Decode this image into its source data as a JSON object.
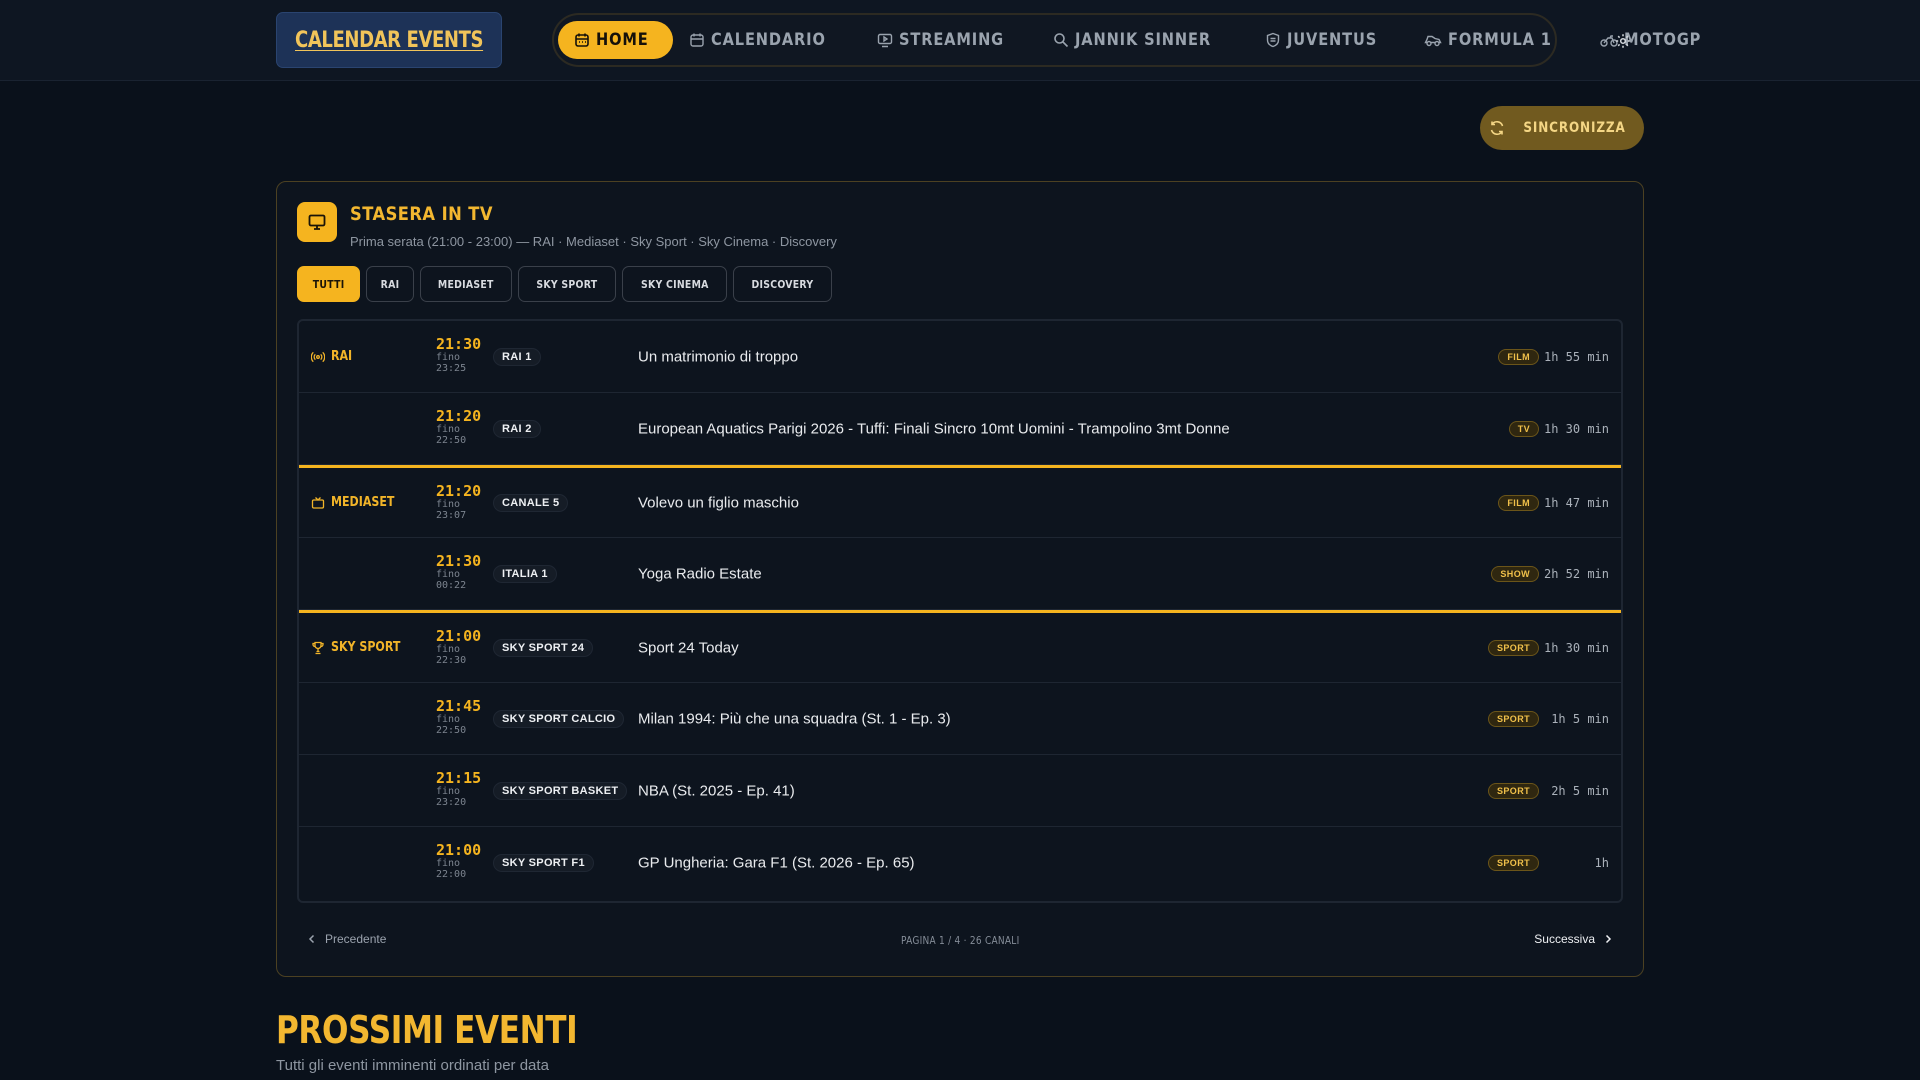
{
  "app": {
    "logo_text": "CALENDAR EVENTS"
  },
  "nav": {
    "items": [
      {
        "label": "HOME",
        "icon": "calendar-icon"
      },
      {
        "label": "CALENDARIO",
        "icon": "calendar-icon"
      },
      {
        "label": "STREAMING",
        "icon": "tv-play-icon"
      },
      {
        "label": "JANNIK SINNER",
        "icon": "search-icon"
      },
      {
        "label": "JUVENTUS",
        "icon": "shield-icon"
      },
      {
        "label": "FORMULA 1",
        "icon": "car-icon"
      },
      {
        "label": "MOTOGP",
        "icon": "motorbike-icon"
      }
    ],
    "active": "HOME",
    "settings_icon": "gear-icon"
  },
  "sync": {
    "label": "SINCRONIZZA",
    "icon": "refresh-icon"
  },
  "tv": {
    "title": "STASERA IN TV",
    "subtitle": "Prima serata (21:00 - 23:00) — RAI · Mediaset · Sky Sport · Sky Cinema · Discovery",
    "filters": [
      "TUTTI",
      "RAI",
      "MEDIASET",
      "SKY SPORT",
      "SKY CINEMA",
      "DISCOVERY"
    ],
    "active_filter": "TUTTI",
    "groups": {
      "rai": "RAI",
      "mediaset": "MEDIASET",
      "skysport": "SKY SPORT"
    },
    "until_label": "fino",
    "rows": [
      {
        "time": "21:30",
        "until": "23:25",
        "channel": "RAI 1",
        "title": "Un matrimonio di troppo",
        "tag": "FILM",
        "duration": "1h 55 min"
      },
      {
        "time": "21:20",
        "until": "22:50",
        "channel": "RAI 2",
        "title": "European Aquatics Parigi 2026 - Tuffi: Finali Sincro 10mt Uomini - Trampolino 3mt Donne",
        "tag": "TV",
        "duration": "1h 30 min"
      },
      {
        "time": "21:20",
        "until": "23:07",
        "channel": "CANALE 5",
        "title": "Volevo un figlio maschio",
        "tag": "FILM",
        "duration": "1h 47 min"
      },
      {
        "time": "21:30",
        "until": "00:22",
        "channel": "ITALIA 1",
        "title": "Yoga Radio Estate",
        "tag": "SHOW",
        "duration": "2h 52 min"
      },
      {
        "time": "21:00",
        "until": "22:30",
        "channel": "SKY SPORT 24",
        "title": "Sport 24 Today",
        "tag": "SPORT",
        "duration": "1h 30 min"
      },
      {
        "time": "21:45",
        "until": "22:50",
        "channel": "SKY SPORT CALCIO",
        "title": "Milan 1994: Più che una squadra (St. 1 - Ep. 3)",
        "tag": "SPORT",
        "duration": "1h 5 min"
      },
      {
        "time": "21:15",
        "until": "23:20",
        "channel": "SKY SPORT BASKET",
        "title": "NBA (St. 2025 - Ep. 41)",
        "tag": "SPORT",
        "duration": "2h 5 min"
      },
      {
        "time": "21:00",
        "until": "22:00",
        "channel": "SKY SPORT F1",
        "title": "GP Ungheria: Gara F1 (St. 2026 - Ep. 65)",
        "tag": "SPORT",
        "duration": "1h"
      }
    ],
    "pager": {
      "prev": "Precedente",
      "info": "PAGINA 1 / 4 · 26 CANALI",
      "next": "Successiva"
    }
  },
  "upcoming": {
    "title": "PROSSIMI EVENTI",
    "subtitle": "Tutti gli eventi imminenti ordinati per data"
  },
  "colors": {
    "accent": "#f5b41f",
    "background": "#0a111b",
    "logo_bg": "#1d3257"
  }
}
